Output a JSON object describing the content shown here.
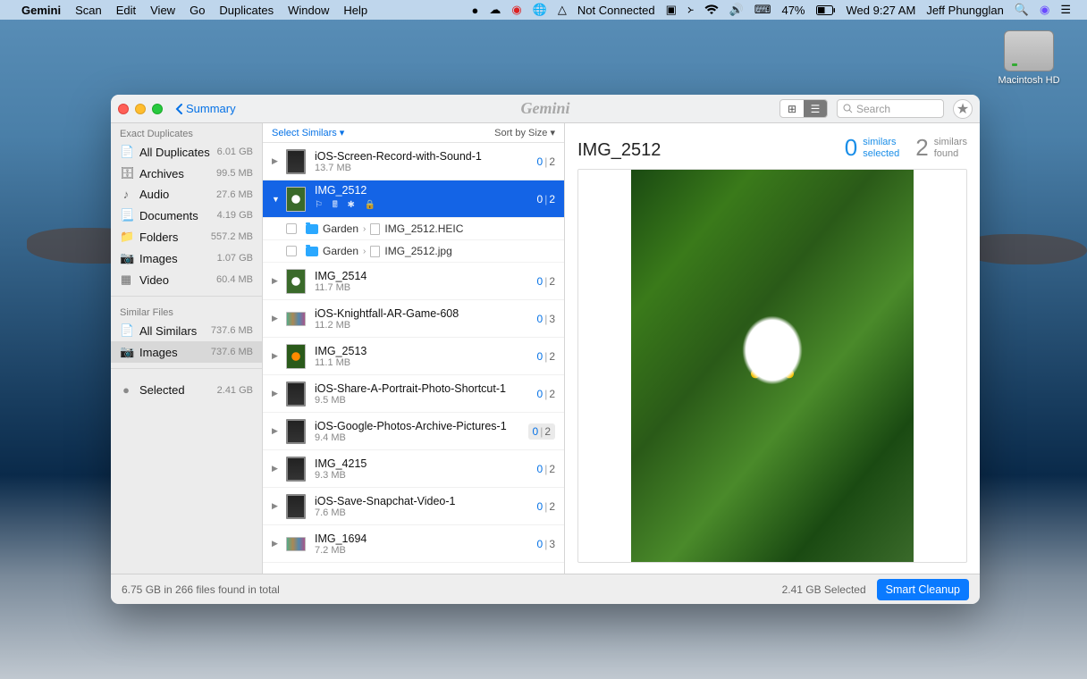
{
  "menubar": {
    "apple": "",
    "app": "Gemini",
    "items": [
      "Scan",
      "Edit",
      "View",
      "Go",
      "Duplicates",
      "Window",
      "Help"
    ],
    "not_connected": "Not Connected",
    "battery": "47%",
    "clock": "Wed 9:27 AM",
    "user": "Jeff Phungglan"
  },
  "desktop": {
    "hd_label": "Macintosh HD"
  },
  "toolbar": {
    "back_label": "Summary",
    "app_title": "Gemini",
    "search_placeholder": "Search"
  },
  "sidebar": {
    "exact_header": "Exact Duplicates",
    "exact": [
      {
        "icon": "📄",
        "label": "All Duplicates",
        "size": "6.01 GB"
      },
      {
        "icon": "🗄",
        "label": "Archives",
        "size": "99.5 MB"
      },
      {
        "icon": "♪",
        "label": "Audio",
        "size": "27.6 MB"
      },
      {
        "icon": "📃",
        "label": "Documents",
        "size": "4.19 GB"
      },
      {
        "icon": "📁",
        "label": "Folders",
        "size": "557.2 MB"
      },
      {
        "icon": "📷",
        "label": "Images",
        "size": "1.07 GB"
      },
      {
        "icon": "▦",
        "label": "Video",
        "size": "60.4 MB"
      }
    ],
    "similar_header": "Similar Files",
    "similar": [
      {
        "icon": "📄",
        "label": "All Similars",
        "size": "737.6 MB"
      },
      {
        "icon": "📷",
        "label": "Images",
        "size": "737.6 MB",
        "selected": true
      }
    ],
    "selected_row": {
      "icon": "✔",
      "label": "Selected",
      "size": "2.41 GB"
    }
  },
  "list": {
    "select_label": "Select Similars ▾",
    "sort_label": "Sort by Size ▾",
    "rows": [
      {
        "name": "iOS-Screen-Record-with-Sound-1",
        "size": "13.7 MB",
        "a": "0",
        "b": "2",
        "thumb": "tb-phone"
      },
      {
        "name": "IMG_2512",
        "size": "",
        "a": "0",
        "b": "2",
        "thumb": "tb-flower",
        "selected": true,
        "expanded": true,
        "children": [
          {
            "folder": "Garden",
            "file": "IMG_2512.HEIC"
          },
          {
            "folder": "Garden",
            "file": "IMG_2512.jpg"
          }
        ]
      },
      {
        "name": "IMG_2514",
        "size": "11.7 MB",
        "a": "0",
        "b": "2",
        "thumb": "tb-flower"
      },
      {
        "name": "iOS-Knightfall-AR-Game-608",
        "size": "11.2 MB",
        "a": "0",
        "b": "3",
        "thumb": "tb-band"
      },
      {
        "name": "IMG_2513",
        "size": "11.1 MB",
        "a": "0",
        "b": "2",
        "thumb": "tb-orange"
      },
      {
        "name": "iOS-Share-A-Portrait-Photo-Shortcut-1",
        "size": "9.5 MB",
        "a": "0",
        "b": "2",
        "thumb": "tb-phone"
      },
      {
        "name": "iOS-Google-Photos-Archive-Pictures-1",
        "size": "9.4 MB",
        "a": "0",
        "b": "2",
        "thumb": "tb-phone",
        "boxed": true
      },
      {
        "name": "IMG_4215",
        "size": "9.3 MB",
        "a": "0",
        "b": "2",
        "thumb": "tb-phone"
      },
      {
        "name": "iOS-Save-Snapchat-Video-1",
        "size": "7.6 MB",
        "a": "0",
        "b": "2",
        "thumb": "tb-phone"
      },
      {
        "name": "IMG_1694",
        "size": "7.2 MB",
        "a": "0",
        "b": "3",
        "thumb": "tb-band"
      }
    ]
  },
  "preview": {
    "title": "IMG_2512",
    "sel_num": "0",
    "sel_l1": "similars",
    "sel_l2": "selected",
    "found_num": "2",
    "found_l1": "similars",
    "found_l2": "found"
  },
  "footer": {
    "summary": "6.75 GB in 266 files found in total",
    "selected": "2.41 GB Selected",
    "button": "Smart Cleanup"
  }
}
